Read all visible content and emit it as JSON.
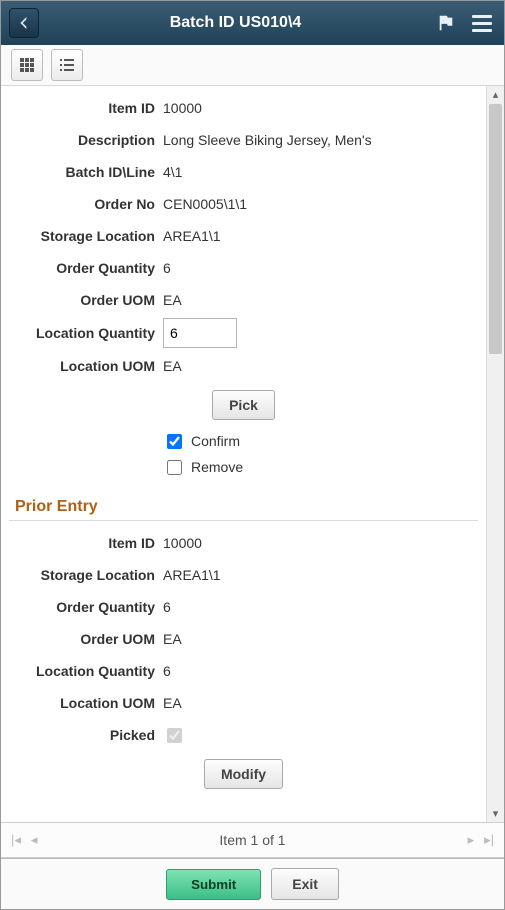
{
  "header": {
    "title": "Batch ID US010\\4"
  },
  "main": {
    "fields": {
      "item_id_label": "Item ID",
      "item_id": "10000",
      "desc_label": "Description",
      "desc": "Long Sleeve Biking Jersey, Men's",
      "batch_line_label": "Batch ID\\Line",
      "batch_line": "4\\1",
      "order_no_label": "Order No",
      "order_no": "CEN0005\\1\\1",
      "storage_label": "Storage Location",
      "storage": "AREA1\\1",
      "order_qty_label": "Order Quantity",
      "order_qty": "6",
      "order_uom_label": "Order UOM",
      "order_uom": "EA",
      "loc_qty_label": "Location Quantity",
      "loc_qty": "6",
      "loc_uom_label": "Location UOM",
      "loc_uom": "EA"
    },
    "pick_btn": "Pick",
    "confirm_label": "Confirm",
    "remove_label": "Remove"
  },
  "prior": {
    "heading": "Prior Entry",
    "fields": {
      "item_id_label": "Item ID",
      "item_id": "10000",
      "storage_label": "Storage Location",
      "storage": "AREA1\\1",
      "order_qty_label": "Order Quantity",
      "order_qty": "6",
      "order_uom_label": "Order UOM",
      "order_uom": "EA",
      "loc_qty_label": "Location Quantity",
      "loc_qty": "6",
      "loc_uom_label": "Location UOM",
      "loc_uom": "EA",
      "picked_label": "Picked"
    },
    "modify_btn": "Modify"
  },
  "pager": {
    "text": "Item 1 of 1"
  },
  "footer": {
    "submit": "Submit",
    "exit": "Exit"
  }
}
